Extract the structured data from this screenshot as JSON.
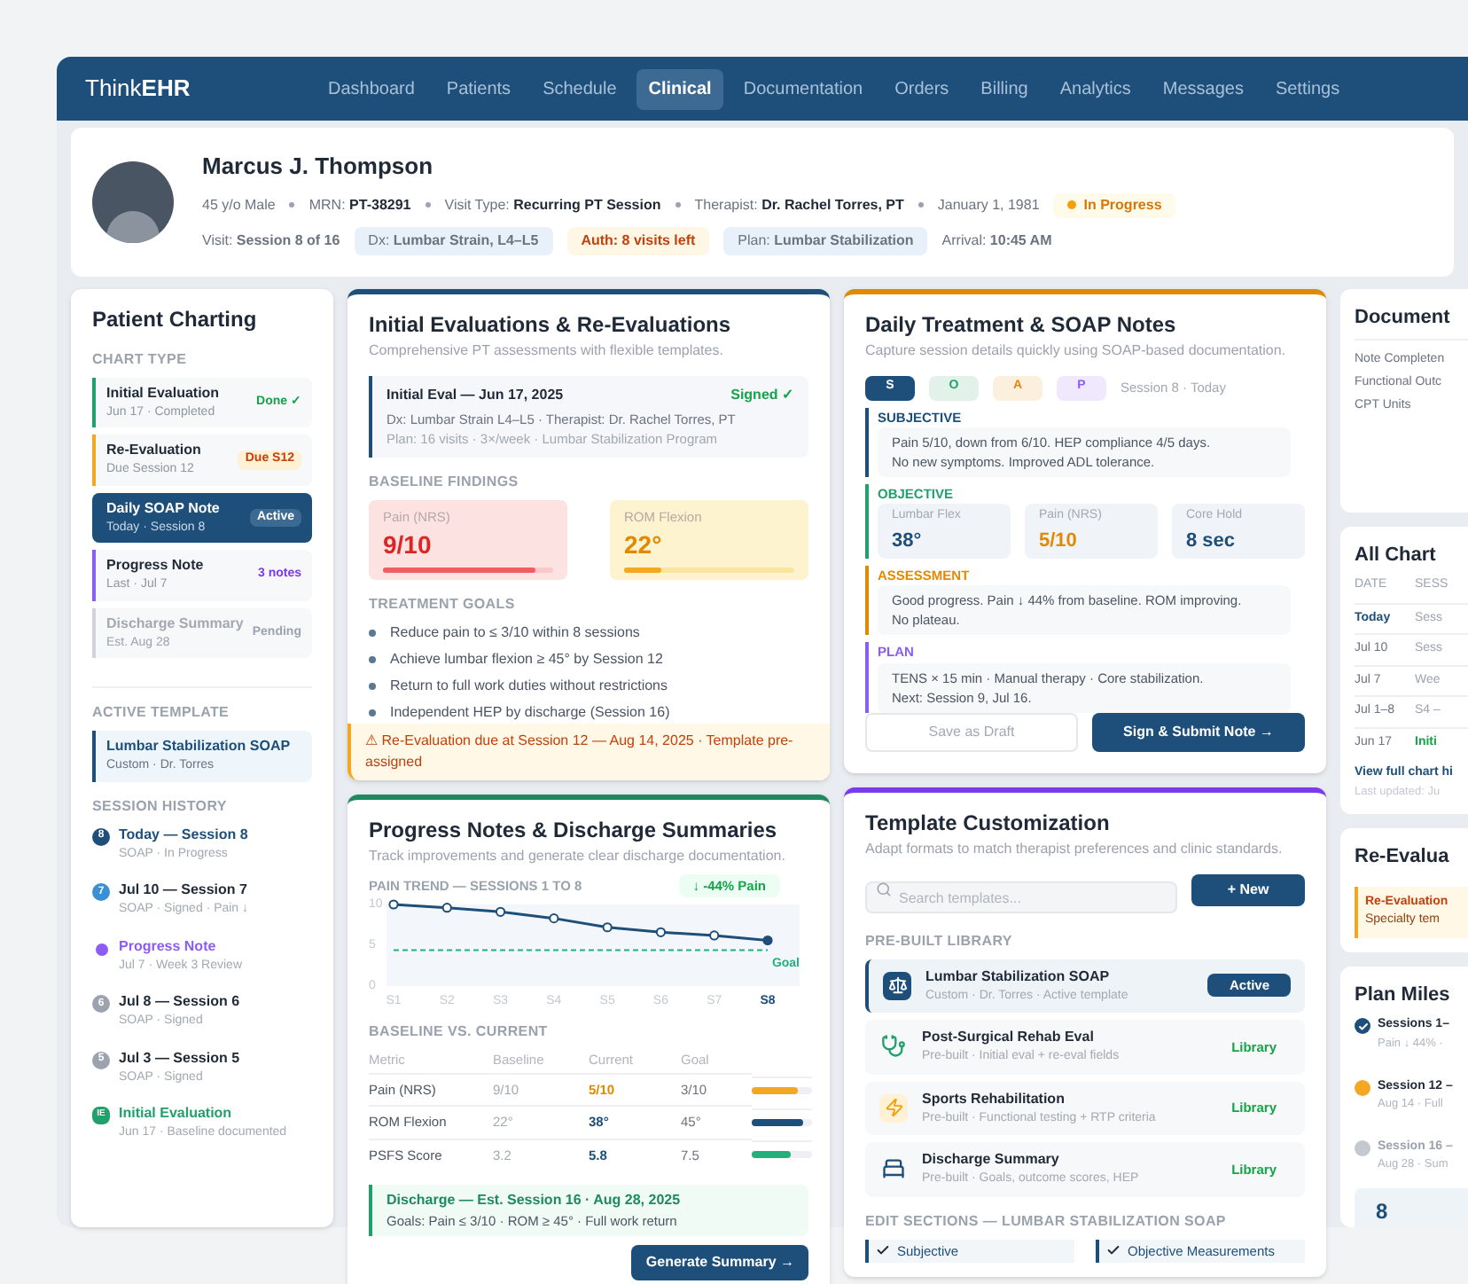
{
  "app": {
    "brand": "Think**EHR**"
  },
  "nav": [
    {
      "label": "Dashboard",
      "selected": false
    },
    {
      "label": "Patients",
      "selected": false
    },
    {
      "label": "Schedule",
      "selected": false
    },
    {
      "label": "Clinical",
      "selected": true
    },
    {
      "label": "Documentation",
      "selected": false
    },
    {
      "label": "Orders",
      "selected": false
    },
    {
      "label": "Billing",
      "selected": false
    },
    {
      "label": "Analytics",
      "selected": false
    },
    {
      "label": "Messages",
      "selected": false
    },
    {
      "label": "Settings",
      "selected": false
    }
  ],
  "patient": {
    "name": "Marcus J. Thompson",
    "meta": [
      {
        "kind": "text",
        "text": "45 y/o Male"
      },
      {
        "kind": "labeled",
        "label": "MRN:",
        "value": "PT-38291"
      },
      {
        "kind": "labeled",
        "label": "Visit Type:",
        "value": "Recurring PT Session"
      },
      {
        "kind": "labeled",
        "label": "Therapist:",
        "value": "Dr. Rachel Torres, PT"
      },
      {
        "kind": "text",
        "text": "January 1, 1981"
      },
      {
        "kind": "status",
        "text": "In Progress",
        "color": "#f59e0b"
      }
    ],
    "chips": [
      {
        "kind": "plain",
        "text": "Visit: **Session 8 of 16**"
      },
      {
        "kind": "blue",
        "text": "Dx: **Lumbar Strain, L4–L5**"
      },
      {
        "kind": "amber",
        "text": "Auth: 8 visits left"
      },
      {
        "kind": "blue",
        "text": "Plan: **Lumbar Stabilization**"
      },
      {
        "kind": "plain",
        "text": "Arrival: **10:45 AM**"
      }
    ]
  },
  "charting": {
    "title": "Patient Charting",
    "chart_type_label": "CHART TYPE",
    "items": [
      {
        "title": "Initial Evaluation",
        "sub": "Jun 17 · Completed",
        "badge": "Done ✓",
        "kind": "done",
        "color": "#22a06b",
        "selected": false,
        "disabled": false
      },
      {
        "title": "Re-Evaluation",
        "sub": "Due Session 12",
        "badge": "Due S12",
        "kind": "due",
        "color": "#f5a623",
        "selected": false,
        "disabled": false
      },
      {
        "title": "Daily SOAP Note",
        "sub": "Today · Session 8",
        "badge": "Active",
        "kind": "active",
        "color": "#1e4f7a",
        "selected": true,
        "disabled": false
      },
      {
        "title": "Progress Note",
        "sub": "Last · Jul 7",
        "badge": "3 notes",
        "kind": "count",
        "color": "#8b5cf6",
        "selected": false,
        "disabled": false
      },
      {
        "title": "Discharge Summary",
        "sub": "Est. Aug 28",
        "badge": "Pending",
        "kind": "pending",
        "color": "#d1d5db",
        "selected": false,
        "disabled": true
      }
    ],
    "template_label": "ACTIVE TEMPLATE",
    "template": {
      "title": "Lumbar Stabilization SOAP",
      "sub": "Custom · Dr. Torres"
    },
    "history_label": "SESSION HISTORY",
    "history": [
      {
        "kind": "number",
        "marker": "8",
        "title": "Today — Session 8",
        "sub": "SOAP · In Progress",
        "color": "#1e4f7a"
      },
      {
        "kind": "number",
        "marker": "7",
        "title": "Jul 10 — Session 7",
        "sub": "SOAP · Signed · Pain ↓",
        "color": "#3b8fd4"
      },
      {
        "kind": "square",
        "title": "Progress Note",
        "sub": "Jul 7 · Week 3 Review",
        "color": "#8b5cf6"
      },
      {
        "kind": "number",
        "marker": "6",
        "title": "Jul 8 — Session 6",
        "sub": "SOAP · Signed",
        "color": "#9ca3af"
      },
      {
        "kind": "number",
        "marker": "5",
        "title": "Jul 3 — Session 5",
        "sub": "SOAP · Signed",
        "color": "#9ca3af"
      },
      {
        "kind": "tag",
        "marker": "IE",
        "title": "Initial Evaluation",
        "sub": "Jun 17 · Baseline documented",
        "color": "#22a06b"
      }
    ]
  },
  "evaluations": {
    "title": "Initial Evaluations & Re-Evaluations",
    "subtitle": "Comprehensive PT assessments with flexible templates.",
    "record": {
      "title": "Initial Eval — Jun 17, 2025",
      "status": "Signed ✓",
      "line1": "Dx: Lumbar Strain L4–L5 · Therapist: Dr. Rachel Torres, PT",
      "line2": "Plan: 16 visits · 3×/week · Lumbar Stabilization Program"
    },
    "baseline_label": "BASELINE FINDINGS",
    "findings": [
      {
        "kind": "red",
        "label": "Pain (NRS)",
        "value": "9/10",
        "level": 0.9
      },
      {
        "kind": "amber",
        "label": "ROM Flexion",
        "value": "22°",
        "level": 0.22
      }
    ],
    "goals_label": "TREATMENT GOALS",
    "goals": [
      "Reduce pain to ≤ 3/10 within 8 sessions",
      "Achieve lumbar flexion ≥ 45° by Session 12",
      "Return to full work duties without restrictions",
      "Independent HEP by discharge (Session 16)"
    ],
    "alert": "⚠ Re-Evaluation due at Session 12 — Aug 14, 2025 · Template pre-assigned"
  },
  "soap": {
    "title": "Daily Treatment & SOAP Notes",
    "subtitle": "Capture session details quickly using SOAP-based documentation.",
    "tabs": [
      {
        "label": "S",
        "selected": true,
        "color": "#1e4f7a"
      },
      {
        "label": "O",
        "selected": false,
        "color": "#22a06b"
      },
      {
        "label": "A",
        "selected": false,
        "color": "#e08a00"
      },
      {
        "label": "P",
        "selected": false,
        "color": "#8b5cf6"
      }
    ],
    "session": "Session 8 · Today",
    "sections": [
      {
        "kind": "text",
        "heading": "SUBJECTIVE",
        "color": "#1e4f7a",
        "lines": [
          "Pain 5/10, down from 6/10. HEP compliance 4/5 days.",
          "No new symptoms. Improved ADL tolerance."
        ]
      },
      {
        "kind": "metrics",
        "heading": "OBJECTIVE",
        "color": "#22a06b",
        "metrics": [
          {
            "label": "Lumbar Flex",
            "value": "38°",
            "color": "#1e4f7a"
          },
          {
            "label": "Pain (NRS)",
            "value": "5/10",
            "color": "#e08a00"
          },
          {
            "label": "Core Hold",
            "value": "8 sec",
            "color": "#1e4f7a"
          }
        ]
      },
      {
        "kind": "text",
        "heading": "ASSESSMENT",
        "color": "#e08a00",
        "lines": [
          "Good progress. Pain ↓ 44% from baseline. ROM improving.",
          "No plateau."
        ]
      },
      {
        "kind": "text",
        "heading": "PLAN",
        "color": "#8b5cf6",
        "lines": [
          "TENS × 15 min · Manual therapy · Core stabilization.",
          "Next: Session 9, Jul 16."
        ]
      }
    ],
    "draft_button": "Save as Draft",
    "submit_button": "Sign & Submit Note →"
  },
  "progress": {
    "title": "Progress Notes & Discharge Summaries",
    "subtitle": "Track improvements and generate clear discharge documentation.",
    "trend_label": "PAIN TREND — SESSIONS 1 TO 8",
    "trend_badge": "↓ -44% Pain",
    "chart_data": {
      "type": "line",
      "x": [
        "S1",
        "S2",
        "S3",
        "S4",
        "S5",
        "S6",
        "S7",
        "S8"
      ],
      "series": [
        {
          "color": "#1e4f7a",
          "marker": "o",
          "values": [
            10,
            9.6,
            9.1,
            8.3,
            7.2,
            6.6,
            6.2,
            5.6
          ]
        },
        {
          "name": "Goal",
          "color": "#22b07d",
          "line_style": "dashed",
          "values": [
            4.4,
            4.4,
            4.4,
            4.4,
            4.4,
            4.4,
            4.4,
            4.4
          ]
        }
      ],
      "ylim": [
        0,
        10
      ],
      "yticks": [
        0,
        5,
        10
      ]
    },
    "compare_label": "BASELINE VS. CURRENT",
    "columns": [
      "Metric",
      "Baseline",
      "Current",
      "Goal"
    ],
    "rows": [
      {
        "metric": "Pain (NRS)",
        "baseline": "9/10",
        "current": "5/10",
        "goal": "3/10",
        "level": 0.75,
        "color": "#f5a623"
      },
      {
        "metric": "ROM Flexion",
        "baseline": "22°",
        "current": "38°",
        "goal": "45°",
        "level": 0.85,
        "color": "#1e4f7a"
      },
      {
        "metric": "PSFS Score",
        "baseline": "3.2",
        "current": "5.8",
        "goal": "7.5",
        "level": 0.65,
        "color": "#22b07d"
      }
    ],
    "discharge": {
      "title": "Discharge — Est. Session 16 · Aug 28, 2025",
      "sub": "Goals: Pain ≤ 3/10 · ROM ≥ 45° · Full work return"
    },
    "button": "Generate Summary →"
  },
  "templates": {
    "title": "Template Customization",
    "subtitle": "Adapt formats to match therapist preferences and clinic standards.",
    "search_placeholder": "Search templates...",
    "new_button": "+ New",
    "library_label": "PRE-BUILT LIBRARY",
    "items": [
      {
        "title": "Lumbar Stabilization SOAP",
        "sub": "Custom · Dr. Torres · Active template",
        "badge": "Active",
        "selected": true
      },
      {
        "title": "Post-Surgical Rehab Eval",
        "sub": "Pre-built · Initial eval + re-eval fields",
        "badge": "Library",
        "selected": false
      },
      {
        "title": "Sports Rehabilitation",
        "sub": "Pre-built · Functional testing + RTP criteria",
        "badge": "Library",
        "selected": false
      },
      {
        "title": "Discharge Summary",
        "sub": "Pre-built · Goals, outcome scores, HEP",
        "badge": "Library",
        "selected": false
      }
    ],
    "sections_label": "EDIT SECTIONS — LUMBAR STABILIZATION SOAP",
    "sections": [
      {
        "label": "Subjective",
        "checked": true
      },
      {
        "label": "Objective Measurements",
        "checked": true
      }
    ]
  },
  "documentation": {
    "title": "Document",
    "rows": [
      "Note Completen",
      "Functional Outc",
      "CPT Units"
    ]
  },
  "chart_notes": {
    "title": "All Chart",
    "columns": [
      "DATE",
      "SESS"
    ],
    "rows": [
      {
        "kind": "current",
        "date": "Today",
        "session": "Sess"
      },
      {
        "kind": "plain",
        "date": "Jul 10",
        "session": "Sess"
      },
      {
        "kind": "plain",
        "date": "Jul 7",
        "session": "Wee"
      },
      {
        "kind": "plain",
        "date": "Jul 1–8",
        "session": "S4 –"
      },
      {
        "kind": "initial",
        "date": "Jun 17",
        "session": "Initi"
      }
    ],
    "link": "View full chart hi",
    "updated": "Last updated: Ju"
  },
  "reeval": {
    "title": "Re-Evalua",
    "alert_title": "Re-Evaluation",
    "alert_sub": "Specialty tem"
  },
  "milestones": {
    "title": "Plan Miles",
    "items": [
      {
        "title": "Sessions 1–",
        "sub": "Pain ↓ 44% ·",
        "color": "#1e4f7a",
        "done": true
      },
      {
        "title": "Session 12 –",
        "sub": "Aug 14 · Full",
        "color": "#f5a623",
        "done": false
      },
      {
        "title": "Session 16 –",
        "sub": "Aug 28 · Sum",
        "color": "#c4c9d0",
        "done": false
      }
    ],
    "stat": "8"
  }
}
